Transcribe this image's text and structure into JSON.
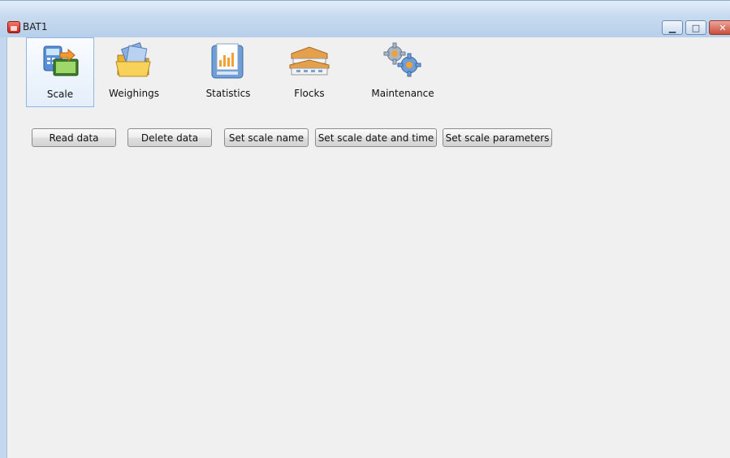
{
  "window": {
    "title": "BAT1",
    "minimize_glyph": "▁",
    "maximize_glyph": "□",
    "close_glyph": "✕"
  },
  "toolbar": {
    "items": [
      {
        "label": "Scale",
        "icon": "scale-icon",
        "selected": true
      },
      {
        "label": "Weighings",
        "icon": "folder-icon",
        "selected": false
      },
      {
        "label": "Statistics",
        "icon": "statistics-chart-icon",
        "selected": false
      },
      {
        "label": "Flocks",
        "icon": "barn-icon",
        "selected": false
      },
      {
        "label": "Maintenance",
        "icon": "gears-icon",
        "selected": false
      }
    ]
  },
  "actions": {
    "read": "Read data",
    "delete": "Delete data",
    "set_name": "Set scale name",
    "set_datetime": "Set scale date and time",
    "set_params": "Set scale parameters"
  },
  "colors": {
    "accent": "#8fb6e3",
    "client_bg": "#f0f0f0",
    "close": "#c94e3b"
  }
}
